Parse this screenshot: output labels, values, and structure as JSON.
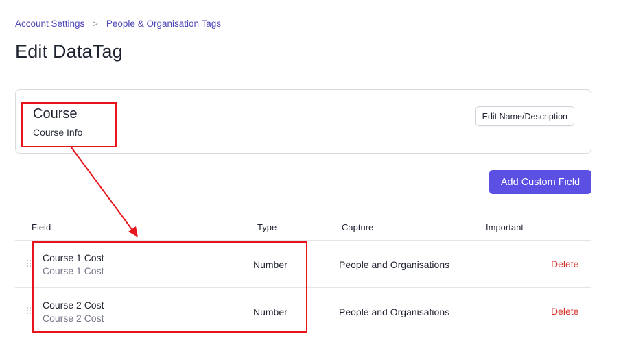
{
  "breadcrumb": {
    "items": [
      "Account Settings",
      "People & Organisation Tags"
    ],
    "separator": ">"
  },
  "page": {
    "title": "Edit DataTag"
  },
  "tag": {
    "name": "Course",
    "description": "Course Info",
    "edit_button": "Edit Name/Description"
  },
  "actions": {
    "add_custom_field": "Add Custom Field"
  },
  "table": {
    "columns": [
      "Field",
      "Type",
      "Capture",
      "Important"
    ],
    "rows": [
      {
        "name": "Course 1 Cost",
        "label": "Course 1 Cost",
        "type": "Number",
        "capture": "People and Organisations",
        "action": "Delete"
      },
      {
        "name": "Course 2 Cost",
        "label": "Course 2 Cost",
        "type": "Number",
        "capture": "People and Organisations",
        "action": "Delete"
      }
    ]
  },
  "colors": {
    "accent": "#5b4fe4",
    "link": "#4f46b8",
    "danger": "#d6342c",
    "annotation": "#e8141b"
  },
  "icons": {
    "drag_handle": "drag-handle-icon",
    "breadcrumb_separator": "chevron-right-icon"
  }
}
